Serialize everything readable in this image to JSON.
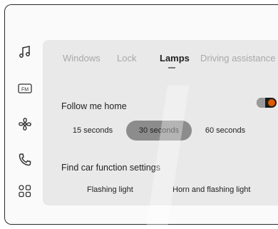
{
  "sidebar": {
    "items": [
      {
        "icon": "music-note-icon"
      },
      {
        "icon": "fm-radio-icon",
        "label": "FM"
      },
      {
        "icon": "fan-icon"
      },
      {
        "icon": "phone-icon"
      },
      {
        "icon": "apps-grid-icon"
      }
    ]
  },
  "tabs": [
    {
      "label": "Windows"
    },
    {
      "label": "Lock"
    },
    {
      "label": "Lamps"
    },
    {
      "label": "Driving assistance"
    }
  ],
  "active_tab": "Lamps",
  "follow_me_home": {
    "label": "Follow me home",
    "enabled": true,
    "options": [
      "15 seconds",
      "30 seconds",
      "60 seconds"
    ],
    "selected": "30 seconds"
  },
  "find_car": {
    "label": "Find car function settings",
    "options": [
      "Flashing light",
      "Horn and flashing light"
    ]
  }
}
